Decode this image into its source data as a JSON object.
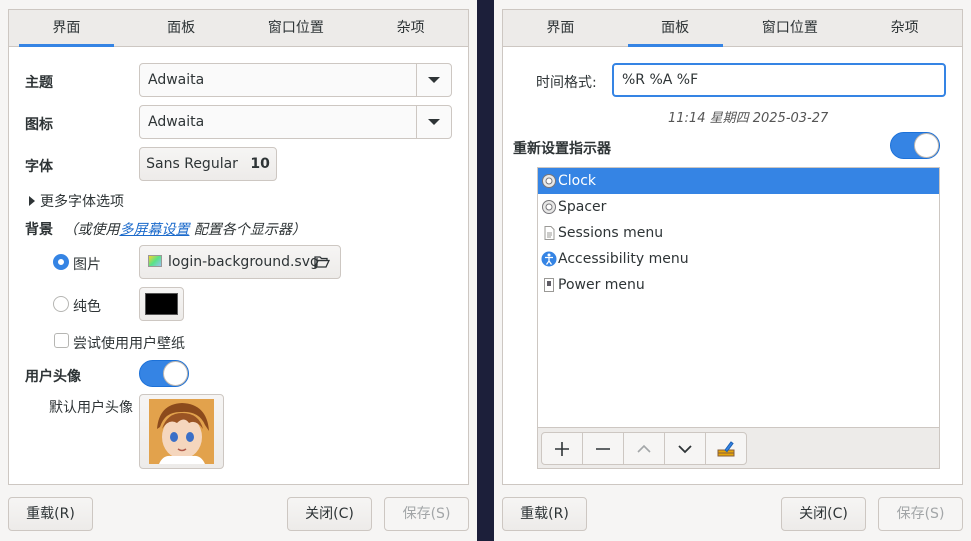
{
  "tabs": [
    "界面",
    "面板",
    "窗口位置",
    "杂项"
  ],
  "left": {
    "theme_label": "主题",
    "theme_value": "Adwaita",
    "icons_label": "图标",
    "icons_value": "Adwaita",
    "font_label": "字体",
    "font_name": "Sans Regular",
    "font_size": "10",
    "more_fonts": "更多字体选项",
    "background_label": "背景",
    "background_note_pre": "（或使用",
    "background_note_link": "多屏幕设置",
    "background_note_post": "配置各个显示器）",
    "image_radio": "图片",
    "image_file": "login-background.svg",
    "color_radio": "纯色",
    "color_value": "#000000",
    "try_wallpaper": "尝试使用用户壁纸",
    "user_avatar_label": "用户头像",
    "default_avatar_label": "默认用户头像"
  },
  "right": {
    "time_format_label": "时间格式:",
    "time_format_value": "%R %A %F",
    "time_preview": "11:14 星期四 2025-03-27",
    "reset_indicators": "重新设置指示器",
    "indicators": [
      {
        "label": "Clock",
        "icon": "gear-icon"
      },
      {
        "label": "Spacer",
        "icon": "gear-icon"
      },
      {
        "label": "Sessions menu",
        "icon": "document-icon"
      },
      {
        "label": "Accessibility menu",
        "icon": "accessibility-icon"
      },
      {
        "label": "Power menu",
        "icon": "power-icon"
      }
    ]
  },
  "buttons": {
    "reload": "重载(R)",
    "close": "关闭(C)",
    "save": "保存(S)"
  },
  "colors": {
    "accent": "#3584e4",
    "background": "#1c1f3a"
  }
}
